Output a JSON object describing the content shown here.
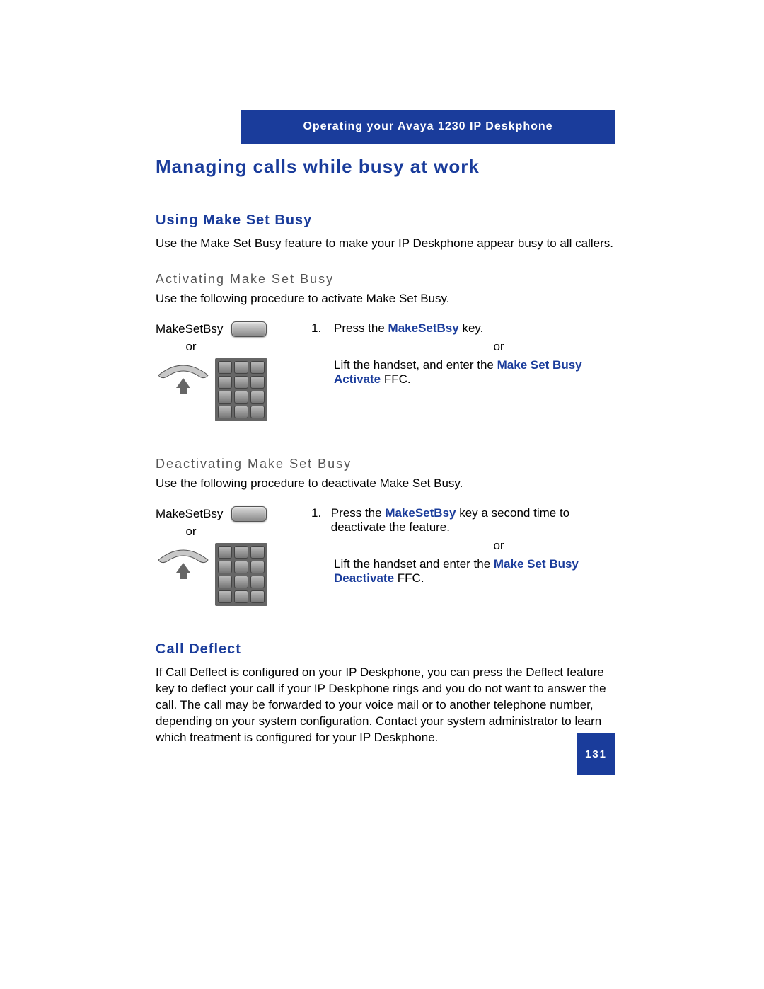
{
  "header": {
    "running_title": "Operating your Avaya 1230 IP Deskphone"
  },
  "sections": {
    "main_title": "Managing calls while busy at work",
    "using_make_set_busy": {
      "title": "Using Make Set Busy",
      "intro": "Use the Make Set Busy feature to make your IP Deskphone appear busy to all callers."
    },
    "activating": {
      "title": "Activating Make Set Busy",
      "intro": "Use the following procedure to activate Make Set Busy.",
      "key_label": "MakeSetBsy",
      "or": "or",
      "step_num": "1.",
      "step1_pre": "Press the ",
      "step1_bold": "MakeSetBsy",
      "step1_post": " key.",
      "or_right": "or",
      "step2_pre": "Lift the handset, and enter the ",
      "step2_bold": "Make Set Busy Activate",
      "step2_post": " FFC."
    },
    "deactivating": {
      "title": "Deactivating Make Set Busy",
      "intro": "Use the following procedure to deactivate Make Set Busy.",
      "key_label": "MakeSetBsy",
      "or": "or",
      "step_num": "1.",
      "step1_pre": "Press the ",
      "step1_bold": "MakeSetBsy",
      "step1_post": " key a second time to deactivate the feature.",
      "or_right": "or",
      "step2_pre": "Lift the handset and enter the ",
      "step2_bold": "Make Set Busy Deactivate",
      "step2_post": " FFC."
    },
    "call_deflect": {
      "title": "Call Deflect",
      "body": "If Call Deflect is configured on your IP Deskphone, you can press the Deflect feature key to deflect your call if your IP Deskphone rings and you do not want to answer the call. The call may be forwarded to your voice mail or to another telephone number, depending on your system configuration. Contact your system administrator to learn which treatment is configured for your IP Deskphone."
    }
  },
  "page_number": "131"
}
